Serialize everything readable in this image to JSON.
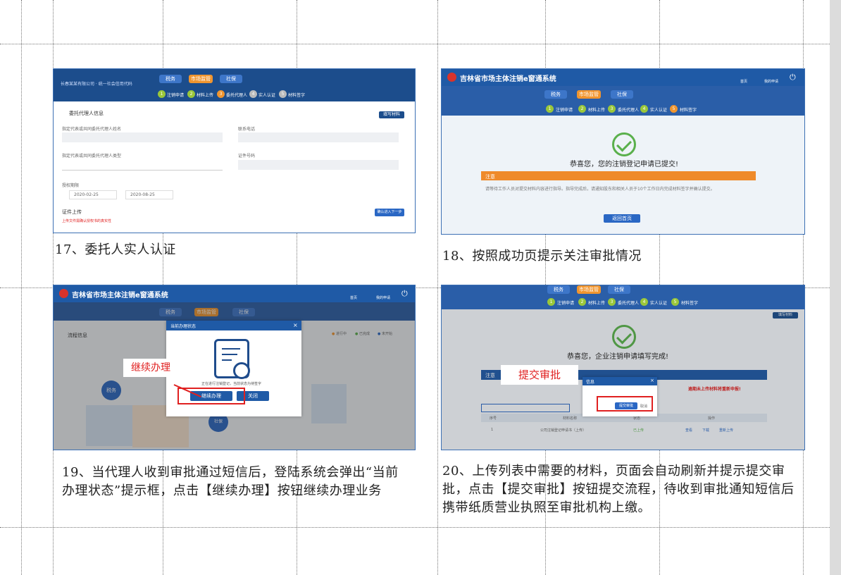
{
  "captions": {
    "c17": "17、委托人实人认证",
    "c18": "18、按照成功页提示关注审批情况",
    "c19": "19、当代理人收到审批通过短信后，登陆系统会弹出“当前办理状态”提示框，点击【继续办理】按钮继续办理业务",
    "c20": "20、上传列表中需要的材料，页面会自动刷新并提示提交审批，点击【提交审批】按钮提交流程，待收到审批通知短信后携带纸质营业执照至审批机构上缴。"
  },
  "system_title": "吉林省市场主体注销e窗通系统",
  "tabs": [
    "税务",
    "市场监管",
    "社保"
  ],
  "steps": [
    "注销申请",
    "材料上传",
    "委托代理人",
    "实人认证",
    "材料签字"
  ],
  "header_icons": {
    "home": "首页",
    "user": "我的申请"
  },
  "s17": {
    "section": "委托代理人信息",
    "modify": "填写材料",
    "name_label": "指定代表或共同委托代理人姓名",
    "phone_label": "联系电话",
    "type_label": "指定代表或共同委托代理人类型",
    "id_label": "证件号码",
    "period_label": "授权期限",
    "date_from": "2020-02-25",
    "date_to": "2020-08-25",
    "upload_label": "证件上传",
    "upload_btn": "确认进入下一步",
    "warn": "上传文件需确认授权书的真实性"
  },
  "s18": {
    "message": "恭喜您，您的注销登记申请已提交!",
    "notice_title": "注意",
    "notice_text": "请等待工作人员对提交材料内容进行指导。指导完成后，请通知股东和相关人员于10个工作日内完成材料签字并确认提交。",
    "back_btn": "返回首页"
  },
  "s19": {
    "flow_label": "流程信息",
    "legend": [
      "进行中",
      "已完成",
      "未开始"
    ],
    "dialog_title": "当前办理状态",
    "dialog_text": "正在进行注销登记，当前状态为待签字",
    "continue_btn": "继续办理",
    "close_btn": "关闭",
    "callout": "继续办理",
    "side_node1": "税务",
    "side_node2": "社保"
  },
  "s20": {
    "message": "恭喜您，企业注销申请填写完成!",
    "notice_title": "注意",
    "warn": "逾期未上传材料将重新申报!",
    "callout": "提交审批",
    "dialog_title": "信息",
    "submit_btn": "提交审批",
    "cancel_btn": "取消",
    "modify": "填写材料",
    "table_headers": [
      "序号",
      "材料名称",
      "状态",
      "操作"
    ],
    "row_no": "1",
    "row_name": "公司注销登记申请书（上传）",
    "row_status": "已上传",
    "row_ops": [
      "查看",
      "下载",
      "重新上传"
    ]
  }
}
